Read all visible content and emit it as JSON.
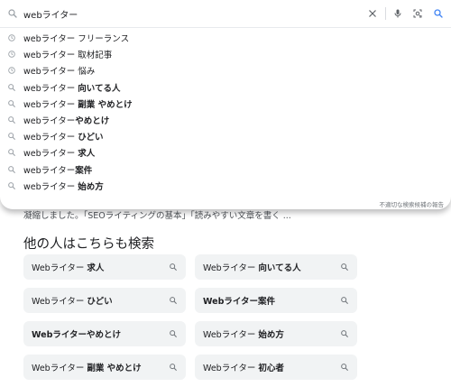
{
  "search": {
    "query": "webライター",
    "suggestions": [
      {
        "icon": "history-icon",
        "prefix": "webライター ",
        "bold": "",
        "plain": "フリーランス"
      },
      {
        "icon": "history-icon",
        "prefix": "webライター ",
        "bold": "",
        "plain": "取材記事"
      },
      {
        "icon": "history-icon",
        "prefix": "webライター ",
        "bold": "",
        "plain": "悩み"
      },
      {
        "icon": "search-icon",
        "prefix": "webライター ",
        "bold": "向いてる人",
        "plain": ""
      },
      {
        "icon": "search-icon",
        "prefix": "webライター ",
        "bold": "副業 やめとけ",
        "plain": ""
      },
      {
        "icon": "search-icon",
        "prefix": "webライター",
        "bold": "やめとけ",
        "plain": ""
      },
      {
        "icon": "search-icon",
        "prefix": "webライター ",
        "bold": "ひどい",
        "plain": ""
      },
      {
        "icon": "search-icon",
        "prefix": "webライター ",
        "bold": "求人",
        "plain": ""
      },
      {
        "icon": "search-icon",
        "prefix": "webライター",
        "bold": "案件",
        "plain": ""
      },
      {
        "icon": "search-icon",
        "prefix": "webライター ",
        "bold": "始め方",
        "plain": ""
      }
    ],
    "report_link": "不適切な検索候補の報告"
  },
  "background": {
    "snippet": "凝縮しました。「SEOライティングの基本」「読みやすい文章を書く ...",
    "people_also_search": {
      "title": "他の人はこちらも検索",
      "chips": [
        {
          "prefix": "Webライター ",
          "bold": "求人"
        },
        {
          "prefix": "Webライター ",
          "bold": "向いてる人"
        },
        {
          "prefix": "Webライター ",
          "bold": "ひどい"
        },
        {
          "prefix": "",
          "bold": "Webライター案件"
        },
        {
          "prefix": "",
          "bold": "Webライターやめとけ"
        },
        {
          "prefix": "Webライター ",
          "bold": "始め方"
        },
        {
          "prefix": "Webライター ",
          "bold": "副業 やめとけ"
        },
        {
          "prefix": "Webライター ",
          "bold": "初心者"
        }
      ]
    }
  }
}
